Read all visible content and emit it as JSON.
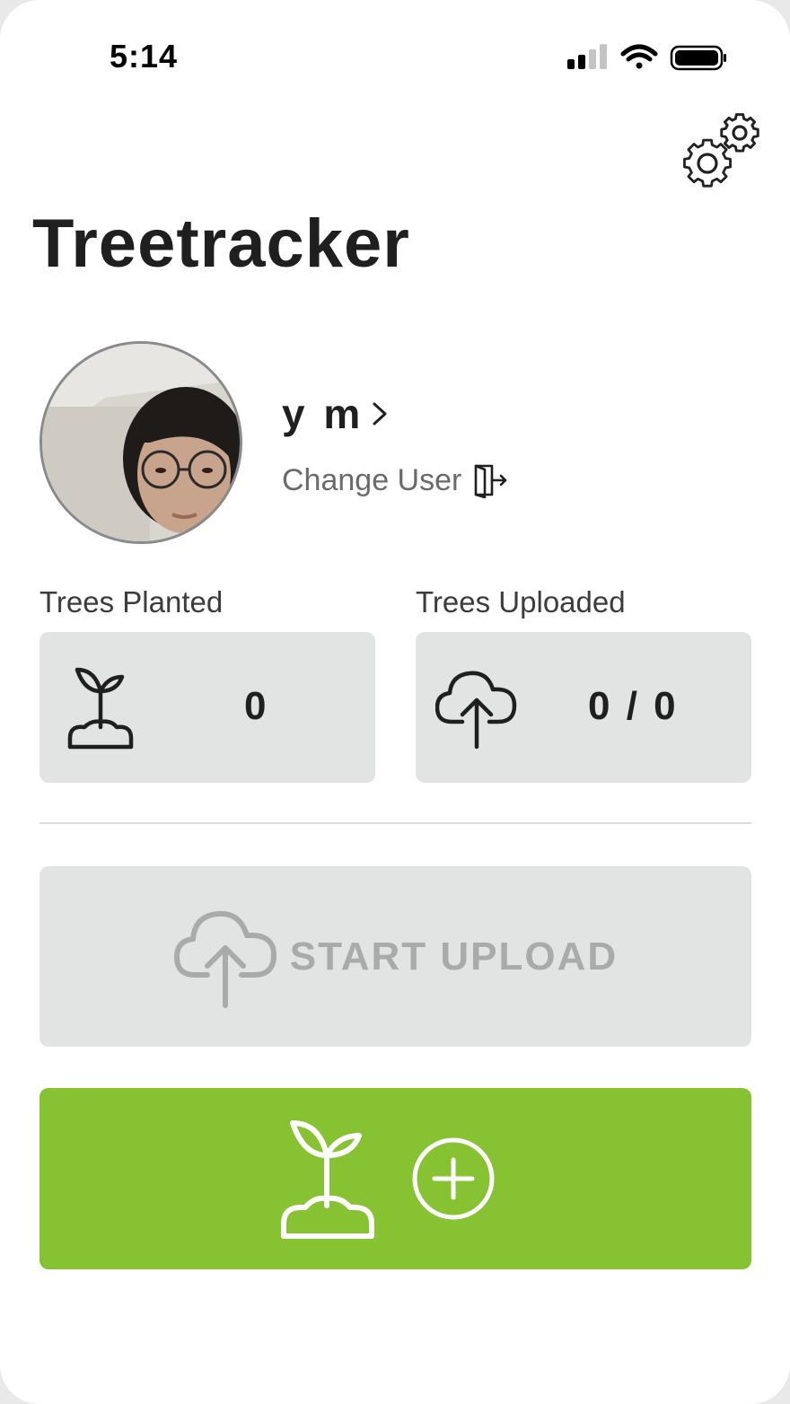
{
  "status_bar": {
    "time": "5:14",
    "icons": [
      "cellular-signal-icon",
      "wifi-icon",
      "battery-icon"
    ]
  },
  "header": {
    "title": "Treetracker",
    "settings_icon": "gears-icon"
  },
  "profile": {
    "avatar": "user-photo",
    "name": "y m",
    "change_user_label": "Change User"
  },
  "stats": {
    "trees_planted": {
      "label": "Trees Planted",
      "value": "0",
      "icon": "sprout-icon"
    },
    "trees_uploaded": {
      "label": "Trees Uploaded",
      "value": "0 / 0",
      "icon": "cloud-upload-icon"
    }
  },
  "actions": {
    "start_upload_label": "START UPLOAD",
    "plant_button_icons": [
      "sprout-icon",
      "plus-circle-icon"
    ]
  },
  "colors": {
    "accent_green": "#86c232",
    "card_gray": "#e2e3e3",
    "disabled_text": "#a9aaaa",
    "title_text": "#1f1f1f"
  }
}
